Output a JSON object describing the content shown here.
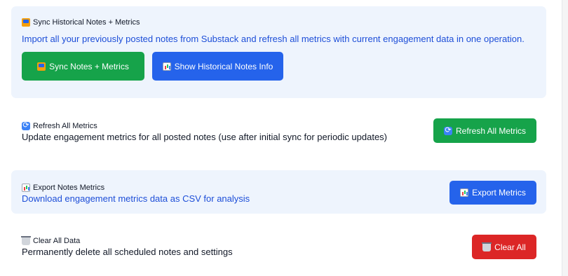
{
  "sync": {
    "title": "Sync Historical Notes + Metrics",
    "description": "Import all your previously posted notes from Substack and refresh all metrics with current engagement data in one operation.",
    "sync_button": "Sync Notes + Metrics",
    "info_button": "Show Historical Notes Info"
  },
  "refresh": {
    "title": "Refresh All Metrics",
    "description": "Update engagement metrics for all posted notes (use after initial sync for periodic updates)",
    "button": "Refresh All Metrics"
  },
  "export": {
    "title": "Export Notes Metrics",
    "description": "Download engagement metrics data as CSV for analysis",
    "button": "Export Metrics"
  },
  "clear": {
    "title": "Clear All Data",
    "description": "Permanently delete all scheduled notes and settings",
    "button": "Clear All"
  },
  "icons": {
    "sync": "inbox-tray-icon",
    "info": "bar-chart-icon",
    "refresh": "refresh-icon",
    "export": "bar-chart-icon",
    "clear": "trash-icon"
  },
  "colors": {
    "green": "#16a34a",
    "blue": "#2563eb",
    "red": "#dc2626",
    "panel": "#eef4fd"
  }
}
